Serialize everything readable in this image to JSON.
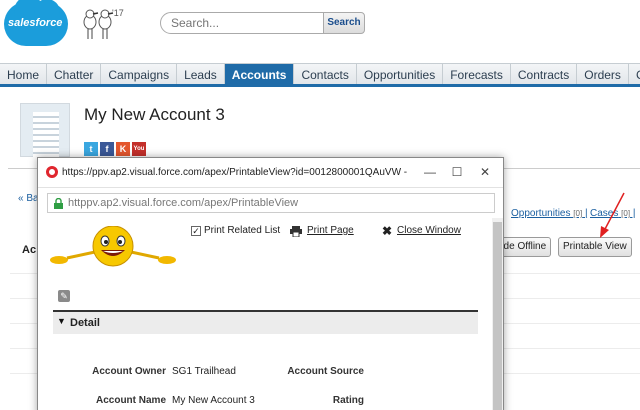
{
  "header": {
    "logo_text": "salesforce",
    "release_year": "'17",
    "search_placeholder": "Search...",
    "search_button": "Search"
  },
  "tabs": [
    "Home",
    "Chatter",
    "Campaigns",
    "Leads",
    "Accounts",
    "Contacts",
    "Opportunities",
    "Forecasts",
    "Contracts",
    "Orders",
    "Cas"
  ],
  "active_tab": "Accounts",
  "account": {
    "title": "My New Account 3",
    "social_icons": [
      "twitter-icon",
      "facebook-icon",
      "klout-icon",
      "youtube-icon"
    ]
  },
  "background": {
    "back_link": "« Ba",
    "section_label": "Ac",
    "related_links": [
      {
        "label": "Opportunities",
        "count": "[0]"
      },
      {
        "label": "Cases",
        "count": "[0]"
      }
    ],
    "buttons": {
      "offline": "ude Offline",
      "printable": "Printable View"
    },
    "arrow_color": "#e02020"
  },
  "popup": {
    "window_title": "https://ppv.ap2.visual.force.com/apex/PrintableView?id=0012800001QAuVW -",
    "address": "httppv.ap2.visual.force.com/apex/PrintableView",
    "toolbar": {
      "print_related_label": "Print Related List",
      "print_related_checked": true,
      "print_page_label": "Print Page",
      "close_window_label": "Close Window"
    },
    "section": {
      "title": "Detail"
    },
    "fields": {
      "owner_label": "Account Owner",
      "owner_value": "SG1 Trailhead",
      "source_label": "Account Source",
      "source_value": "",
      "name_label": "Account Name",
      "name_value": "My New Account 3",
      "rating_label": "Rating",
      "rating_value": ""
    }
  },
  "colors": {
    "brand": "#1b9ddb",
    "tab_active": "#1f6ba8",
    "opera_red": "#e0262e"
  }
}
